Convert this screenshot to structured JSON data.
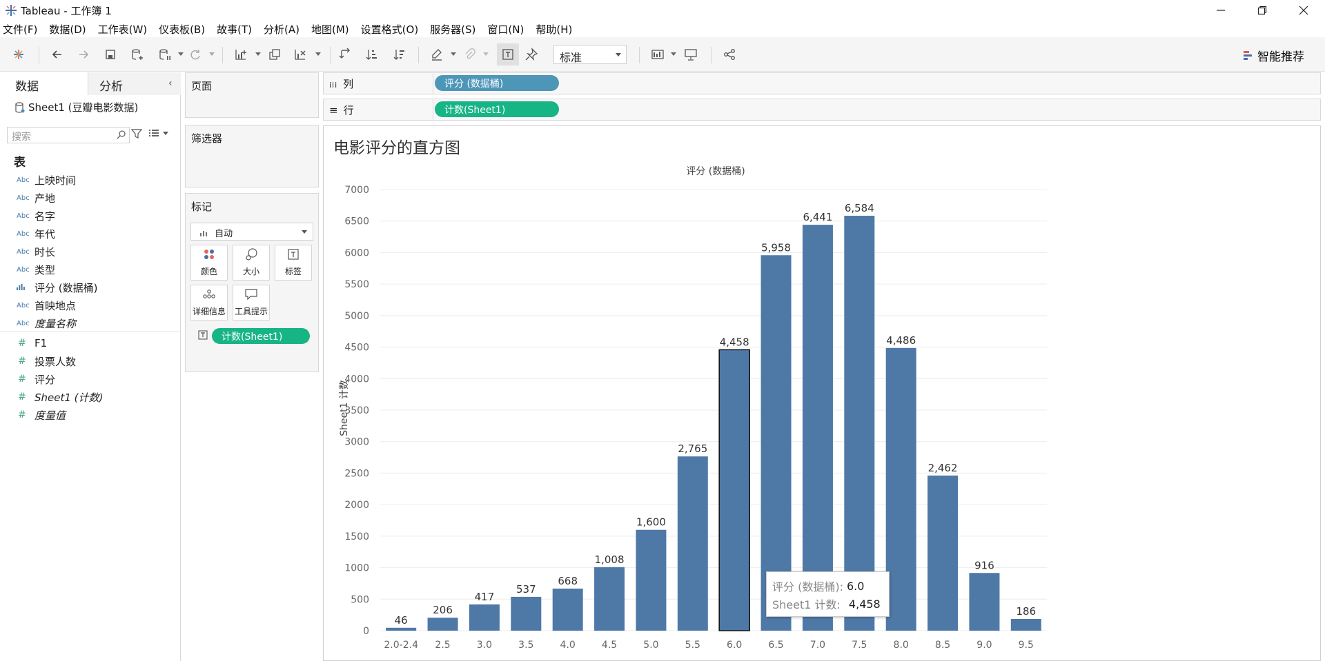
{
  "window": {
    "title": "Tableau - 工作簿 1"
  },
  "menu": [
    "文件(F)",
    "数据(D)",
    "工作表(W)",
    "仪表板(B)",
    "故事(T)",
    "分析(A)",
    "地图(M)",
    "设置格式(O)",
    "服务器(S)",
    "窗口(N)",
    "帮助(H)"
  ],
  "toolbar": {
    "fit": "标准",
    "recommend": "智能推荐"
  },
  "datapane": {
    "tab_data": "数据",
    "tab_analysis": "分析",
    "datasource": "Sheet1 (豆瓣电影数据)",
    "search_placeholder": "搜索",
    "table_header": "表",
    "dimensions": [
      {
        "type": "Abc",
        "name": "上映时间",
        "italic": false
      },
      {
        "type": "Abc",
        "name": "产地",
        "italic": false
      },
      {
        "type": "Abc",
        "name": "名字",
        "italic": false
      },
      {
        "type": "Abc",
        "name": "年代",
        "italic": false
      },
      {
        "type": "Abc",
        "name": "时长",
        "italic": false
      },
      {
        "type": "Abc",
        "name": "类型",
        "italic": false
      },
      {
        "type": "bin",
        "name": "评分 (数据桶)",
        "italic": false
      },
      {
        "type": "Abc",
        "name": "首映地点",
        "italic": false
      },
      {
        "type": "Abc",
        "name": "度量名称",
        "italic": true
      }
    ],
    "measures": [
      {
        "type": "#",
        "name": "F1",
        "italic": false
      },
      {
        "type": "#",
        "name": "投票人数",
        "italic": false
      },
      {
        "type": "#",
        "name": "评分",
        "italic": false
      },
      {
        "type": "#",
        "name": "Sheet1 (计数)",
        "italic": true
      },
      {
        "type": "#",
        "name": "度量值",
        "italic": true
      }
    ]
  },
  "cards": {
    "pages": "页面",
    "filters": "筛选器",
    "marks": "标记",
    "marks_type": "自动",
    "buttons": [
      "颜色",
      "大小",
      "标签",
      "详细信息",
      "工具提示"
    ],
    "label_pill": "计数(Sheet1)"
  },
  "shelves": {
    "columns_label": "列",
    "columns_pill": "评分 (数据桶)",
    "rows_label": "行",
    "rows_pill": "计数(Sheet1)"
  },
  "sheet": {
    "title": "电影评分的直方图"
  },
  "chart_data": {
    "type": "bar",
    "title": "电影评分的直方图",
    "xlabel": "评分 (数据桶)",
    "ylabel": "Sheet1 计数",
    "categories": [
      "2.0-2.4",
      "2.5",
      "3.0",
      "3.5",
      "4.0",
      "4.5",
      "5.0",
      "5.5",
      "6.0",
      "6.5",
      "7.0",
      "7.5",
      "8.0",
      "8.5",
      "9.0",
      "9.5"
    ],
    "values": [
      46,
      206,
      417,
      537,
      668,
      1008,
      1600,
      2765,
      4458,
      5958,
      6441,
      6584,
      4486,
      2462,
      916,
      186
    ],
    "labels": [
      "46",
      "206",
      "417",
      "537",
      "668",
      "1,008",
      "1,600",
      "2,765",
      "4,458",
      "5,958",
      "6,441",
      "6,584",
      "4,486",
      "2,462",
      "916",
      "186"
    ],
    "ylim": [
      0,
      7000
    ],
    "yticks": [
      "0",
      "500",
      "1000",
      "1500",
      "2000",
      "2500",
      "3000",
      "3500",
      "4000",
      "4500",
      "5000",
      "5500",
      "6000",
      "6500",
      "7000"
    ],
    "grid": true,
    "bar_color": "#4e79a7",
    "selected_index": 8
  },
  "tooltip": {
    "k1": "评分 (数据桶):",
    "v1": "6.0",
    "k2": "Sheet1 计数:",
    "v2": "4,458"
  }
}
